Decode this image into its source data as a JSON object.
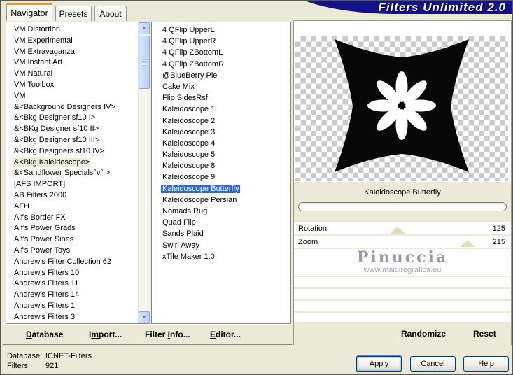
{
  "window": {
    "banner_title": "Filters Unlimited 2.0",
    "banner_color": "#12128B"
  },
  "tabs": [
    {
      "label": "Navigator",
      "active": true
    },
    {
      "label": "Presets",
      "active": false
    },
    {
      "label": "About",
      "active": false
    }
  ],
  "category_list": {
    "selected_index": 12,
    "selected_value": "&<Bkg Kaleidoscope>",
    "items": [
      "VM Distortion",
      "VM Experimental",
      "VM Extravaganza",
      "VM Instant Art",
      "VM Natural",
      "VM Toolbox",
      "VM",
      "&<Background Designers IV>",
      "&<Bkg Designer sf10 I>",
      "&<BKg Designer sf10 II>",
      "&<Bkg Designer sf10 III>",
      "&<Bkg Designers sf10 IV>",
      "&<Bkg Kaleidoscope>",
      "&<Sandflower Specials°v° >",
      "[AFS IMPORT]",
      "AB Filters 2000",
      "AFH",
      "Alf's Border FX",
      "Alf's Power Grads",
      "Alf's Power Sines",
      "Alf's Power Toys",
      "Andrew's Filter Collection 62",
      "Andrew's Filters 10",
      "Andrew's Filters 11",
      "Andrew's Filters 14",
      "Andrew's Filters 1",
      "Andrew's Filters 3"
    ]
  },
  "filter_list": {
    "selected_index": 14,
    "selected_value": "Kaleidoscope Butterfly",
    "selection_color": "#316AC5",
    "items": [
      "4 QFlip UpperL",
      "4 QFlip UpperR",
      "4 QFlip ZBottomL",
      "4 QFlip ZBottomR",
      "@BlueBerry Pie",
      "Cake Mix",
      "Flip SidesRsf",
      "Kaleidoscope 1",
      "Kaleidoscope 2",
      "Kaleidoscope 3",
      "Kaleidoscope 4",
      "Kaleidoscope 5",
      "Kaleidoscope 8",
      "Kaleidoscope 9",
      "Kaleidoscope Butterfly",
      "Kaleidoscope Persian",
      "Nomads Rug",
      "Quad Flip",
      "Sands Plaid",
      "Swirl Away",
      "xTile Maker 1.0"
    ]
  },
  "preview": {
    "caption": "Kaleidoscope Butterfly",
    "shape_color": "#070707",
    "checker_color": "#CACACA"
  },
  "sliders": [
    {
      "label": "Rotation",
      "value": "125"
    },
    {
      "label": "Zoom",
      "value": "215"
    }
  ],
  "watermark": {
    "name": "Pinuccia",
    "url": "www.maidiregrafica.eu"
  },
  "toolbar": {
    "items": [
      {
        "pre": "",
        "u": "D",
        "post": "atabase"
      },
      {
        "pre": "I",
        "u": "m",
        "post": "port..."
      },
      {
        "pre": "Filter ",
        "u": "I",
        "post": "nfo..."
      },
      {
        "pre": "",
        "u": "E",
        "post": "ditor..."
      }
    ],
    "randomize": "Randomize",
    "reset": "Reset"
  },
  "status": {
    "database_label": "Database:",
    "database_value": "ICNET-Filters",
    "filters_label": "Filters:",
    "filters_value": "921"
  },
  "buttons": {
    "apply": "Apply",
    "cancel": "Cancel",
    "help": "Help"
  },
  "scrollbar": {
    "up_glyph": "▲",
    "down_glyph": "▼"
  }
}
